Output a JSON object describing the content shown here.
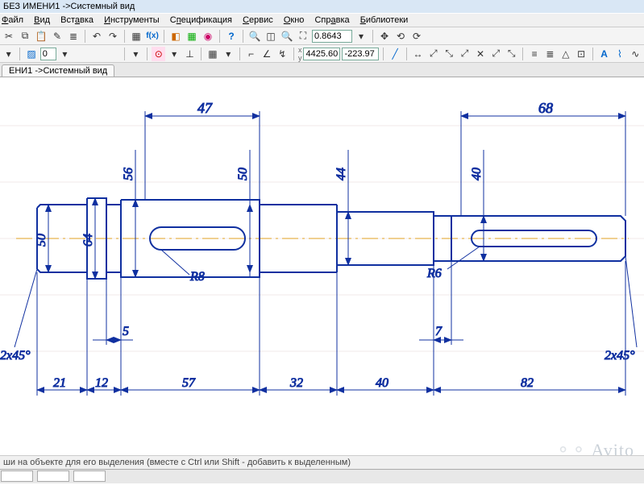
{
  "window": {
    "title": "БЕЗ ИМЕНИ1 ->Системный вид"
  },
  "menu": {
    "items": [
      "Файл",
      "Вид",
      "Вставка",
      "Инструменты",
      "Спецификация",
      "Сервис",
      "Окно",
      "Справка",
      "Библиотеки"
    ]
  },
  "toolbar1": {
    "zoom": "0.8643"
  },
  "toolbar2": {
    "layer_num": "0",
    "coord_x": "4425.60",
    "coord_y": "-223.97"
  },
  "tab": {
    "label": "ЕНИ1 ->Системный вид"
  },
  "status": {
    "hint": "ши на объекте для его выделения (вместе с Ctrl или Shift - добавить к выделенным)"
  },
  "watermark": "Avito",
  "drawing": {
    "dims_horizontal_top": {
      "d47": "47",
      "d68": "68"
    },
    "dims_vertical": {
      "d50": "50",
      "d64": "64",
      "d56": "56",
      "d50b": "50",
      "d44": "44",
      "d40": "40"
    },
    "radii": {
      "r8": "R8",
      "r6": "R6"
    },
    "dims_horizontal_bottom": {
      "d21": "21",
      "d12": "12",
      "d5": "5",
      "d57": "57",
      "d32": "32",
      "d7": "7",
      "d40": "40",
      "d82": "82"
    },
    "chamfers": {
      "left": "2x45°",
      "right": "2x45°"
    }
  }
}
